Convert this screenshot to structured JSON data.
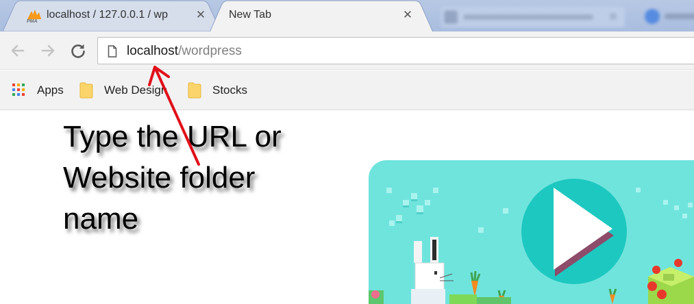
{
  "tabs": [
    {
      "title": "localhost / 127.0.0.1 / wp",
      "favicon": "phpmyadmin-icon",
      "active": false
    },
    {
      "title": "New Tab",
      "active": true
    }
  ],
  "toolbar": {
    "url_host": "localhost",
    "url_path": "/wordpress"
  },
  "bookmarks": [
    {
      "label": "Apps",
      "icon": "apps-grid-icon"
    },
    {
      "label": "Web Design",
      "icon": "folder-icon"
    },
    {
      "label": "Stocks",
      "icon": "folder-icon"
    }
  ],
  "annotation": {
    "line1": "Type the URL or",
    "line2": "Website folder",
    "line3": "name"
  },
  "colors": {
    "tabstrip": "#a9bddf",
    "toolbar": "#f2f2f2",
    "arrow": "#e0101a",
    "doodle_bg": "#6fe4dd",
    "play_circle": "#1dc8c0"
  }
}
